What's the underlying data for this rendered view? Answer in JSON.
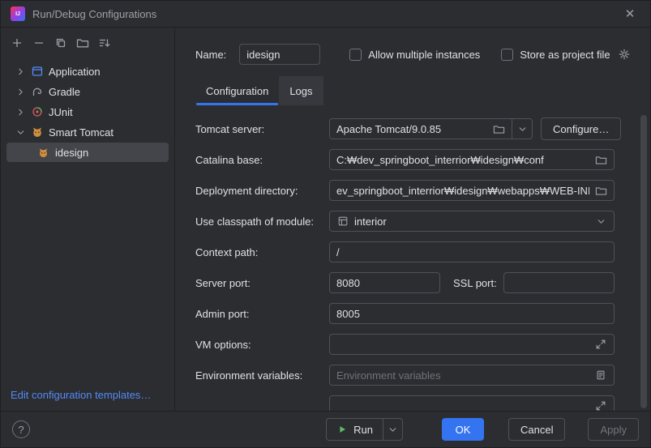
{
  "titlebar": {
    "title": "Run/Debug Configurations",
    "close_glyph": "✕"
  },
  "sidebar": {
    "tree": {
      "application": "Application",
      "gradle": "Gradle",
      "junit": "JUnit",
      "smart_tomcat": "Smart Tomcat",
      "idesign": "idesign"
    },
    "edit_link": "Edit configuration templates…"
  },
  "header": {
    "name_label": "Name:",
    "name_value": "idesign",
    "allow_multiple": "Allow multiple instances",
    "store_as_project": "Store as project file"
  },
  "tabs": {
    "configuration": "Configuration",
    "logs": "Logs"
  },
  "form": {
    "tomcat_label": "Tomcat server:",
    "tomcat_value": "Apache Tomcat/9.0.85",
    "configure_button": "Configure…",
    "catalina_label": "Catalina base:",
    "catalina_value": "C:₩dev_springboot_interrior₩idesign₩conf",
    "deploy_label": "Deployment directory:",
    "deploy_value": "ev_springboot_interrior₩idesign₩webapps₩WEB-INF",
    "module_label": "Use classpath of module:",
    "module_value": "interior",
    "context_label": "Context path:",
    "context_value": "/",
    "server_port_label": "Server port:",
    "server_port_value": "8080",
    "ssl_port_label": "SSL port:",
    "ssl_port_value": "",
    "admin_port_label": "Admin port:",
    "admin_port_value": "8005",
    "vm_label": "VM options:",
    "vm_value": "",
    "env_label": "Environment variables:",
    "env_placeholder": "Environment variables"
  },
  "footer": {
    "run": "Run",
    "ok": "OK",
    "cancel": "Cancel",
    "apply": "Apply",
    "help_glyph": "?"
  },
  "colors": {
    "accent": "#3574f0",
    "link": "#548af7",
    "run_green": "#5fb865"
  }
}
